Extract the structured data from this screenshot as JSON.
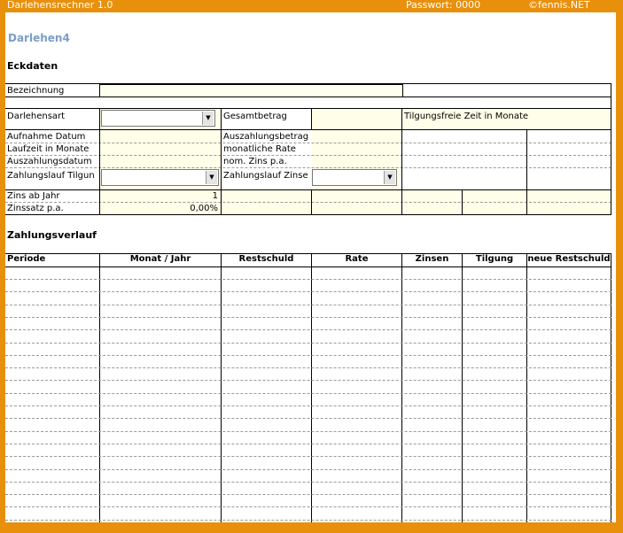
{
  "header": {
    "app_title": "Darlehensrechner 1.0",
    "password": "Passwort: 0000",
    "copyright": "©fennis.NET"
  },
  "sheet": {
    "title": "Darlehen4",
    "eckdaten_heading": "Eckdaten",
    "zahlungsverlauf_heading": "Zahlungsverlauf"
  },
  "form": {
    "bezeichnung_label": "Bezeichnung",
    "bezeichnung_value": "",
    "darlehensart_label": "Darlehensart",
    "darlehensart_value": "",
    "gesamtbetrag_label": "Gesamtbetrag",
    "tilgungsfreie_label": "Tilgungsfreie Zeit in Monate",
    "aufnahme_label": "Aufnahme Datum",
    "auszahlungsbetrag_label": "Auszahlungsbetrag",
    "laufzeit_label": "Laufzeit in Monate",
    "monatliche_rate_label": "monatliche Rate",
    "auszahlungsdatum_label": "Auszahlungsdatum",
    "nom_zins_label": "nom. Zins p.a.",
    "zahlungslauf_tilgung_label": "Zahlungslauf Tilgun",
    "zahlungslauf_tilgung_value": "",
    "zahlungslauf_zinsen_label": "Zahlungslauf Zinse",
    "zahlungslauf_zinsen_value": "",
    "zins_ab_jahr_label": "Zins ab Jahr",
    "zins_ab_jahr_value": "1",
    "zinssatz_label": "Zinssatz p.a.",
    "zinssatz_value": "0,00%"
  },
  "schedule": {
    "columns": [
      "Periode",
      "Monat / Jahr",
      "Restschuld",
      "Rate",
      "Zinsen",
      "Tilgung",
      "neue Restschuld"
    ],
    "rows": []
  },
  "colors": {
    "frame": "#e8900c",
    "title": "#7b9dc8",
    "input_fill": "#fffee8"
  },
  "icons": {
    "dropdown": "chevron-down-icon"
  }
}
